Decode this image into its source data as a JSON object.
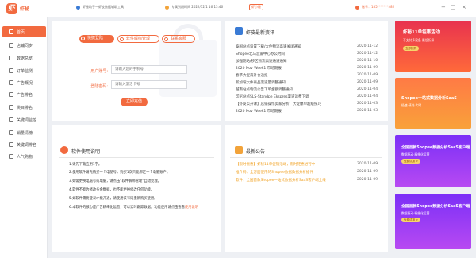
{
  "app": {
    "logo_char": "虾",
    "name": "虾秘"
  },
  "topbar": {
    "notice": "虾秘助手—虾皮数据辅助工具",
    "expiry": "专属到期时间 2022/12/1 16:13:46",
    "vip_badge": "虾小秘",
    "account": "账号：185*******482",
    "window_buttons": {
      "minimize": "−",
      "maximize": "□",
      "close": "×"
    }
  },
  "sidebar": {
    "items": [
      {
        "label": "首页",
        "icon": "home-icon"
      },
      {
        "label": "店铺同步",
        "icon": "store-sync-icon"
      },
      {
        "label": "数据总览",
        "icon": "data-overview-icon"
      },
      {
        "label": "订单监测",
        "icon": "order-icon"
      },
      {
        "label": "广告概况",
        "icon": "ad-icon"
      },
      {
        "label": "广告排名",
        "icon": "ad-rank-icon"
      },
      {
        "label": "类目排名",
        "icon": "category-icon"
      },
      {
        "label": "关键词监控",
        "icon": "keyword-icon"
      },
      {
        "label": "销量清榜",
        "icon": "sales-icon"
      },
      {
        "label": "关键词排名",
        "icon": "keyword-rank-icon"
      },
      {
        "label": "人气购物",
        "icon": "popular-icon"
      }
    ]
  },
  "login": {
    "tabs": [
      "快捷登陆",
      "软件解绑管理",
      "联系客服"
    ],
    "account_label": "用户账号:",
    "account_placeholder": "请输入您的手机号",
    "password_label": "登陆密码:",
    "password_placeholder": "请输入激活卡号",
    "submit": "立即充值"
  },
  "news": {
    "title": "虾皮最新资讯",
    "items": [
      {
        "title": "泰国站点设置下载/大件物流高速关闭通知",
        "date": "2020-11-12"
      },
      {
        "title": "Shopee北马恋爱中心办公时间",
        "date": "2020-11-12"
      },
      {
        "title": "加强期站/移区物流高速通道通知",
        "date": "2020-11-10"
      },
      {
        "title": "2020 Nov Week1 市场期报",
        "date": "2020-11-09"
      },
      {
        "title": "春节大促海外仓通报",
        "date": "2020-11-09"
      },
      {
        "title": "新加坡大件商品渠道量调整通知",
        "date": "2020-11-09"
      },
      {
        "title": "越南站点物流公告下单金额调整通知",
        "date": "2020-11-04"
      },
      {
        "title": "印尼站点SLS-Standpe Ekspres渠道运费下调",
        "date": "2020-11-04"
      },
      {
        "title": "【虾皮公开课】店铺操作卖家分析，大促爆单超级技巧",
        "date": "2020-11-03"
      },
      {
        "title": "2020 Nov Week1 市场期报",
        "date": "2020-11-03"
      }
    ]
  },
  "instructions": {
    "title": "软件使用说明",
    "lines": [
      "1.请先下载应用1字。",
      "2.使用软件请先购买一个电脑号，购买1次只能绑定一个电脑账户。",
      "3.如需更换电脑号或电脑，请点击“软件解绑管理”自动处理。",
      "4.软件不能为修改多余数据，也不能更换修改任何功能。",
      "5.如软件需要登录才能开通，请使用该号码重新购买使用。"
    ],
    "last_line_prefix": "6.本软件的核心是广告精细化运营，可以实时跟踪数据，功能使用请点击查看",
    "last_line_link": "使用说明"
  },
  "announcements": {
    "title": "最新公告",
    "items": [
      {
        "title": "【限时优惠】虾秘11单促销活动，限时钜惠进行中",
        "date": "2020-11-09"
      },
      {
        "title": "推介码：全方面使用的Shopee数据数据分析插件",
        "date": "2020-11-09"
      },
      {
        "title": "软件：全国首款Shopee一站式数据分析SaaS客户端上线",
        "date": "2020-11-09"
      }
    ]
  },
  "ads": [
    {
      "headline": "虾秘11单钜惠活动",
      "sub": "不支持多设备·最低折扣",
      "pill": "立即抢购",
      "color_top": "#e8324f",
      "color_bottom": "#ff6a3a"
    },
    {
      "headline": "Shopee一站式数据分析SaaS",
      "sub": "极速·精准·实时",
      "pill": "",
      "color_top": "#ff7a45",
      "color_bottom": "#f9a13a"
    },
    {
      "headline": "全国首款Shopee数据分析SaaS客户端",
      "sub": "数据驱动·精细化运营",
      "pill": "免费试用 >",
      "color_top": "#7b2ff7",
      "color_bottom": "#b84af2"
    },
    {
      "headline": "全国首款Shopee数据分析SaaS客户端",
      "sub": "数据驱动·精细化运营",
      "pill": "免费试用 >",
      "color_top": "#7b2ff7",
      "color_bottom": "#b84af2"
    }
  ],
  "colors": {
    "accent": "#f26a3f",
    "announcement": "#f0a020"
  }
}
